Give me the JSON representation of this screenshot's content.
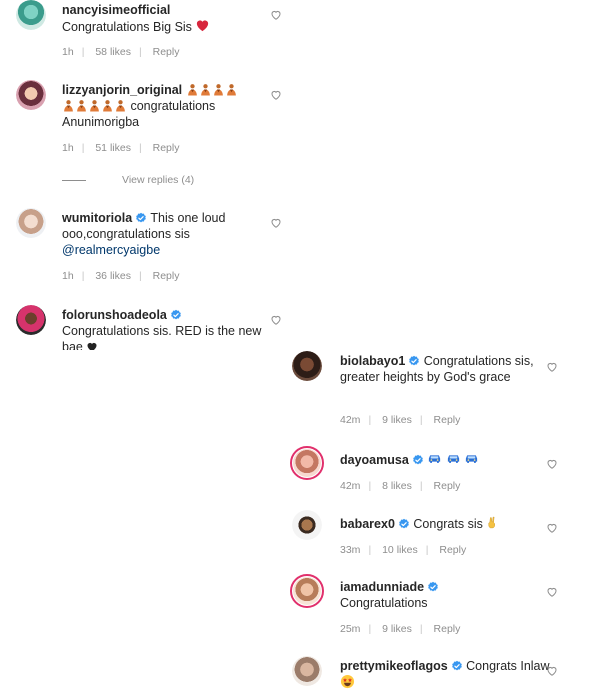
{
  "left_comments": [
    {
      "username": "nancyisimeofficial",
      "verified": false,
      "text": "Congratulations Big Sis",
      "time": "1h",
      "likes": "58 likes",
      "reply": "Reply"
    },
    {
      "username": "lizzyanjorin_original",
      "verified": false,
      "text": "congratulations Anunimorigba",
      "time": "1h",
      "likes": "51 likes",
      "reply": "Reply",
      "view_replies": "View replies (4)"
    },
    {
      "username": "wumitoriola",
      "verified": true,
      "text": "This one loud ooo,congratulations sis",
      "mention": "@realmercyaigbe",
      "time": "1h",
      "likes": "36 likes",
      "reply": "Reply"
    },
    {
      "username": "folorunshoadeola",
      "verified": true,
      "text": "Congratulations sis. RED is the new bae"
    }
  ],
  "right_comments": [
    {
      "username": "biolabayo1",
      "verified": true,
      "text": "Congratulations sis, greater heights by God's grace",
      "time": "42m",
      "likes": "9 likes",
      "reply": "Reply"
    },
    {
      "username": "dayoamusa",
      "verified": true,
      "text": "",
      "time": "42m",
      "likes": "8 likes",
      "reply": "Reply"
    },
    {
      "username": "babarex0",
      "verified": true,
      "text": "Congrats sis",
      "time": "33m",
      "likes": "10 likes",
      "reply": "Reply"
    },
    {
      "username": "iamadunniade",
      "verified": true,
      "text": "Congratulations",
      "time": "25m",
      "likes": "9 likes",
      "reply": "Reply"
    },
    {
      "username": "prettymikeoflagos",
      "verified": true,
      "text": "Congrats Inlaw"
    }
  ],
  "icons": {
    "like": "heart-outline-icon",
    "verified": "verified-badge-icon",
    "emoji_heart": "red-heart-emoji",
    "emoji_person": "person-emoji",
    "emoji_car": "car-emoji",
    "emoji_hand": "victory-hand-emoji",
    "emoji_star_eyes": "star-struck-emoji"
  },
  "colors": {
    "text": "#262626",
    "muted": "#8e8e8e",
    "verified": "#3897f0",
    "mention": "#00376b",
    "story_ring": "#e1306c"
  }
}
